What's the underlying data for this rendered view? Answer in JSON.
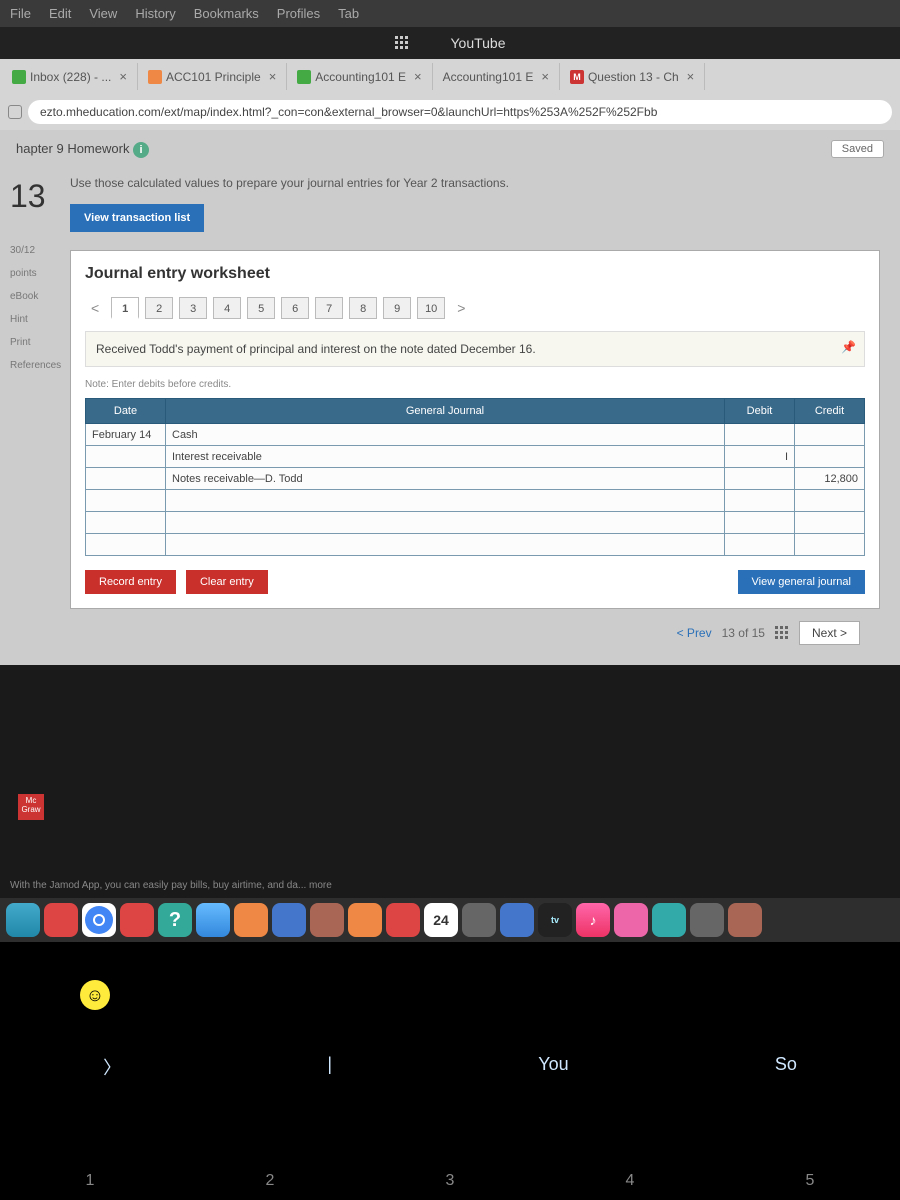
{
  "menubar": [
    "File",
    "Edit",
    "View",
    "History",
    "Bookmarks",
    "Profiles",
    "Tab"
  ],
  "youtube": "YouTube",
  "tabs": [
    {
      "label": "Inbox (228) - ...",
      "fav": "fav-green"
    },
    {
      "label": "ACC101 Principle",
      "fav": "fav-orange"
    },
    {
      "label": "Accounting101 E",
      "fav": "fav-green"
    },
    {
      "label": "Accounting101 E",
      "fav": ""
    },
    {
      "label": "Question 13 - Ch",
      "fav": "fav-red",
      "favtext": "M"
    }
  ],
  "url": "ezto.mheducation.com/ext/map/index.html?_con=con&external_browser=0&launchUrl=https%253A%252F%252Fbb",
  "page_header": {
    "title": "hapter 9 Homework",
    "saved": "Saved"
  },
  "question_num": "13",
  "side": {
    "a": "30/12",
    "b": "points",
    "c": "eBook",
    "d": "Hint",
    "e": "Print",
    "f": "References"
  },
  "instruction": "Use those calculated values to prepare your journal entries for Year 2 transactions.",
  "btn_view_list": "View transaction list",
  "ws_title": "Journal entry worksheet",
  "steps": [
    "1",
    "2",
    "3",
    "4",
    "5",
    "6",
    "7",
    "8",
    "9",
    "10"
  ],
  "txn_desc": "Received Todd's payment of principal and interest on the note dated December 16.",
  "note": "Note: Enter debits before credits.",
  "table": {
    "headers": {
      "date": "Date",
      "gj": "General Journal",
      "debit": "Debit",
      "credit": "Credit"
    },
    "rows": [
      {
        "date": "February 14",
        "acct": "Cash",
        "debit": "",
        "credit": ""
      },
      {
        "date": "",
        "acct": "Interest receivable",
        "debit": "I",
        "credit": ""
      },
      {
        "date": "",
        "acct": "Notes receivable—D. Todd",
        "debit": "",
        "credit": "12,800"
      },
      {
        "date": "",
        "acct": "",
        "debit": "",
        "credit": ""
      },
      {
        "date": "",
        "acct": "",
        "debit": "",
        "credit": ""
      },
      {
        "date": "",
        "acct": "",
        "debit": "",
        "credit": ""
      }
    ]
  },
  "btns": {
    "record": "Record entry",
    "clear": "Clear entry",
    "view": "View general journal"
  },
  "nav": {
    "prev": "< Prev",
    "count": "13 of 15",
    "next": "Next >"
  },
  "promo": "With the Jamod App, you can easily pay bills, buy airtime, and da...   more",
  "dock_cal": "24",
  "dock_tv": "tv",
  "kb": {
    "a": "〉",
    "b": "|",
    "c": "You",
    "d": "So"
  },
  "kbrow": [
    "1",
    "2",
    "3",
    "4",
    "5"
  ]
}
